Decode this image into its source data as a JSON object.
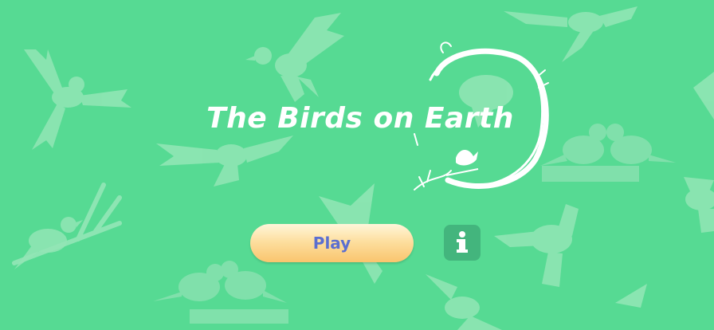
{
  "game": {
    "title": "The Birds on Earth",
    "background_color": "#56DA93",
    "silhouette_color": "#93E6B6",
    "accent_color": "#FFFFFF"
  },
  "menu": {
    "play_label": "Play",
    "play_button_color": "#FBD48A",
    "play_label_color": "#5B6FD0",
    "info_button_color": "#43B57D",
    "info_icon": "info-icon"
  }
}
